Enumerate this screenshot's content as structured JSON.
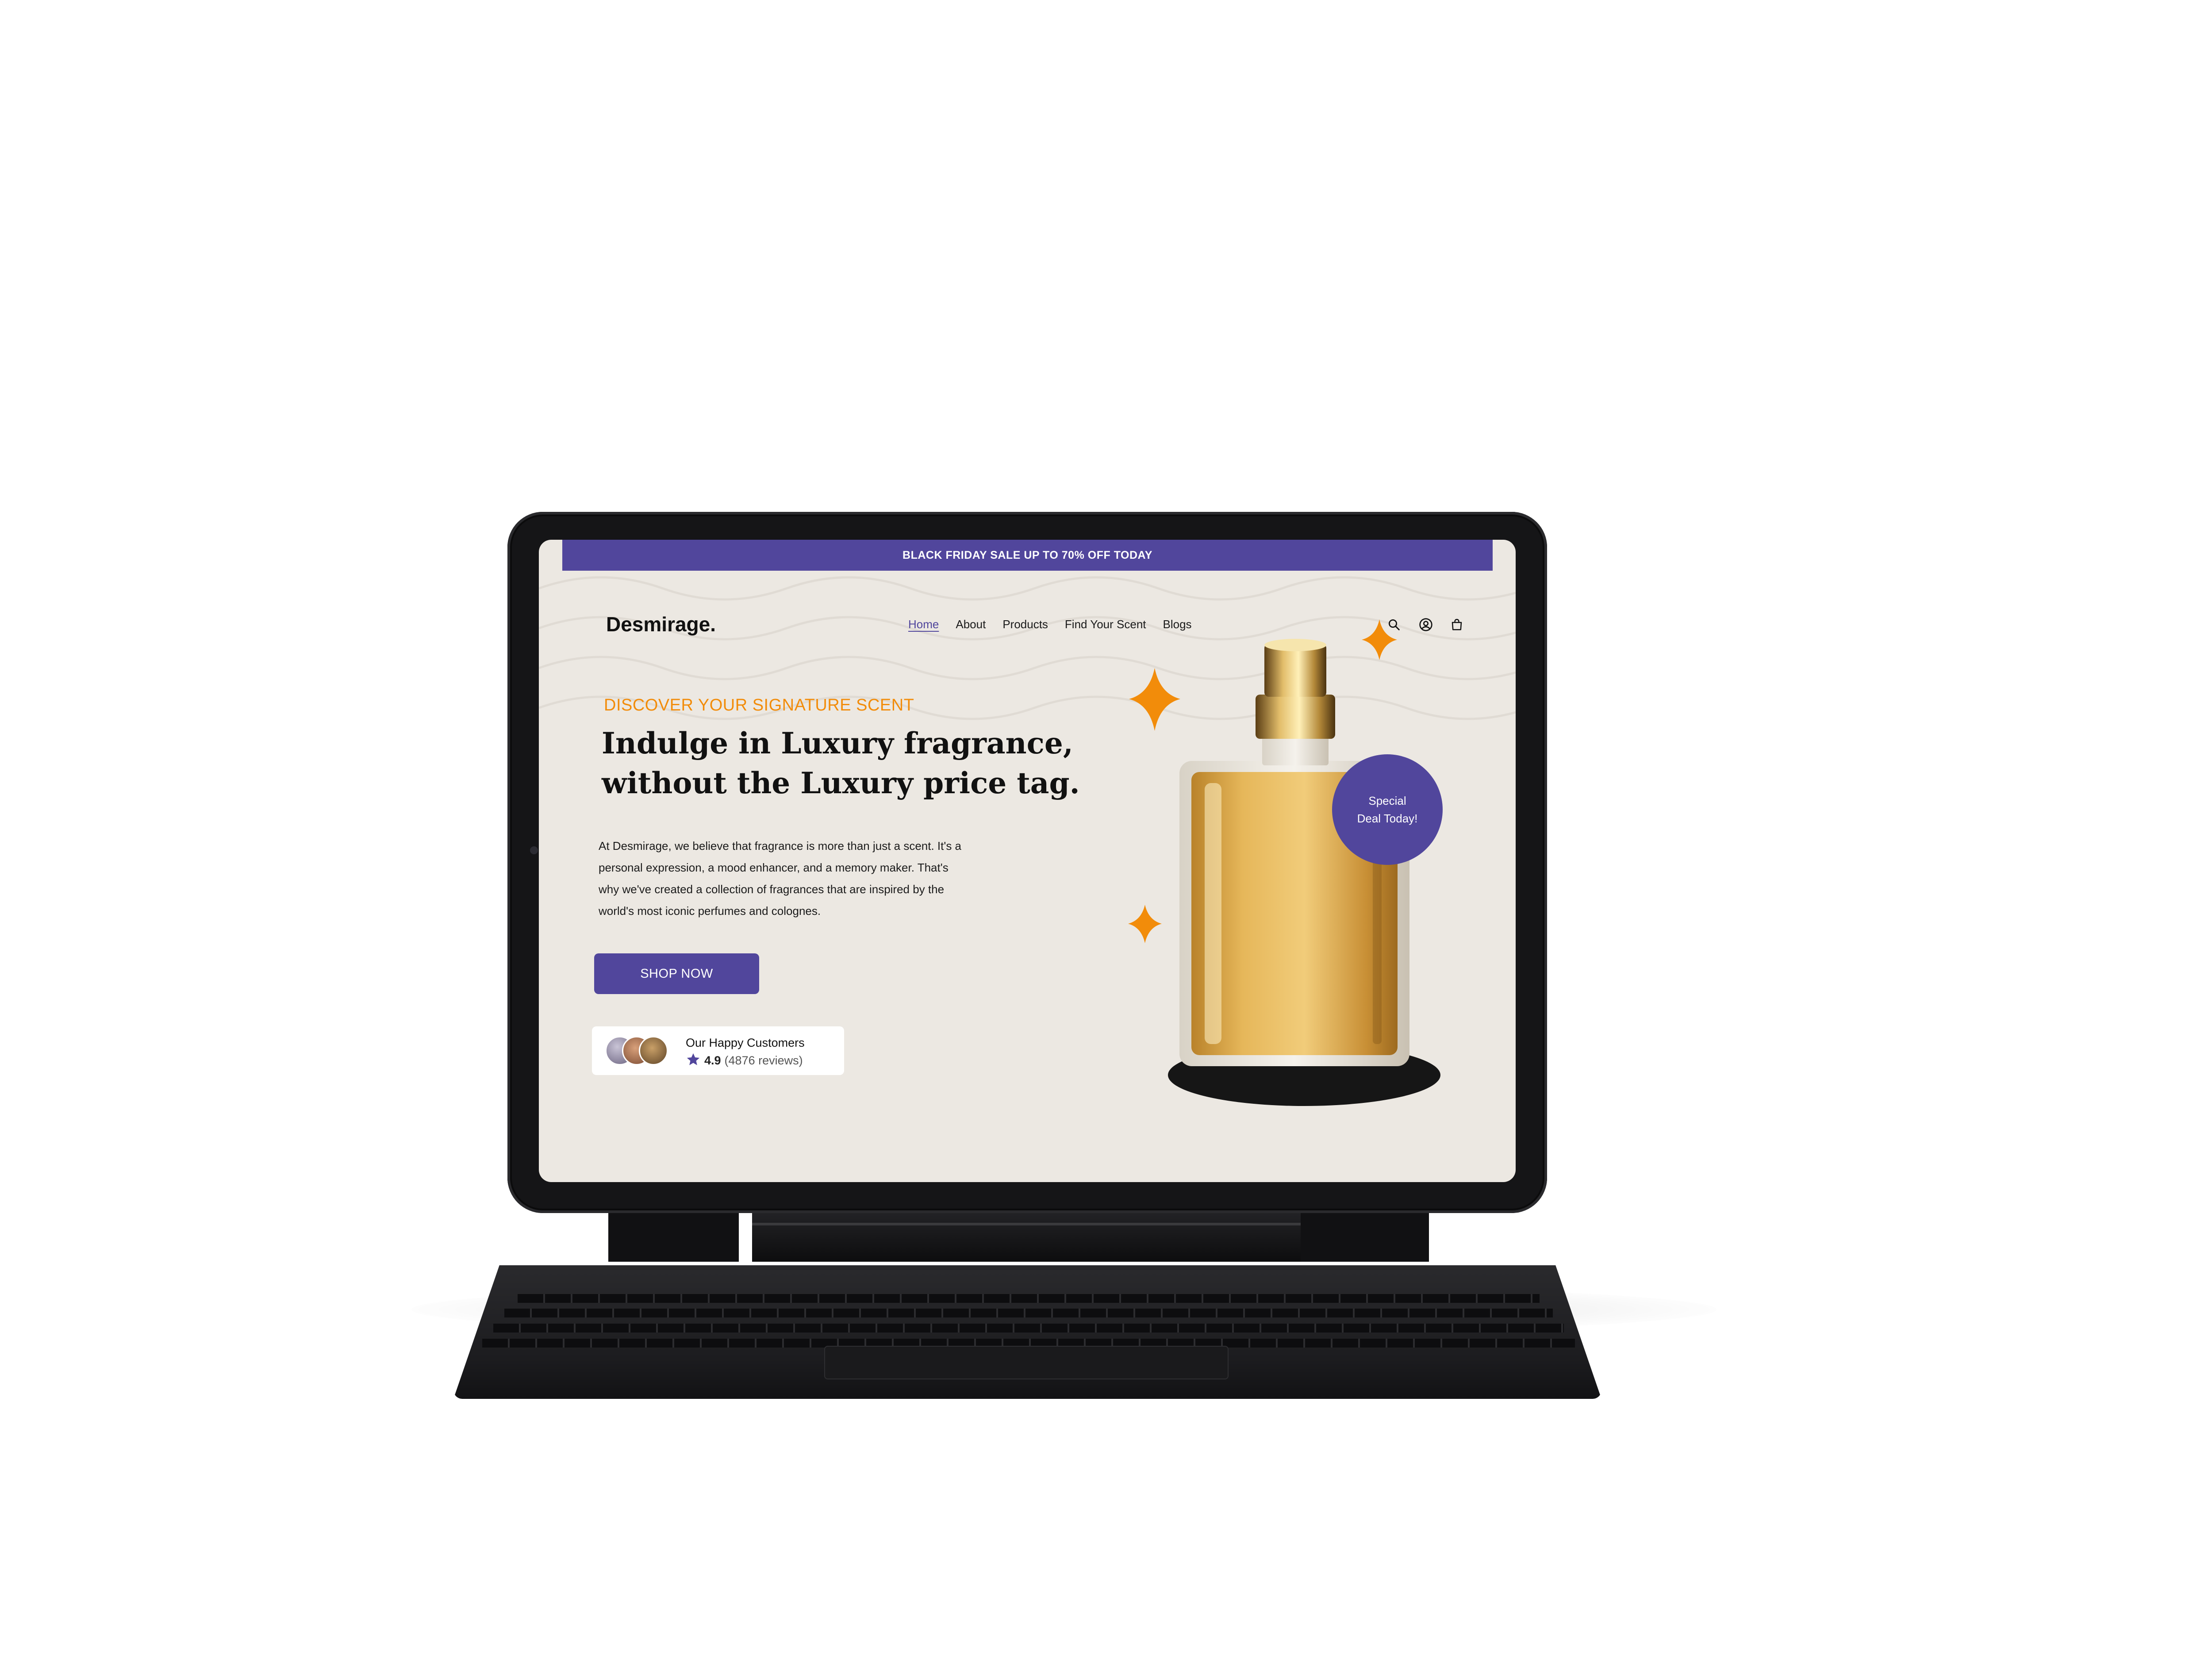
{
  "promo": {
    "text": "BLACK FRIDAY SALE UP TO 70% OFF TODAY"
  },
  "header": {
    "brand": "Desmirage.",
    "nav": [
      "Home",
      "About",
      "Products",
      "Find Your Scent",
      "Blogs"
    ],
    "active_nav": "Home",
    "icons": [
      "search-icon",
      "account-icon",
      "cart-icon"
    ]
  },
  "hero": {
    "kicker": "DISCOVER YOUR SIGNATURE SCENT",
    "headline_line1": "Indulge in Luxury fragrance,",
    "headline_line2": "without the Luxury price tag.",
    "description_lines": [
      "At Desmirage, we believe that fragrance is more than just a scent. It's a",
      "personal expression, a mood enhancer, and a memory maker. That's",
      "why we've created a collection of fragrances that are inspired by the",
      "world's most iconic perfumes and colognes."
    ],
    "cta_label": "SHOP NOW"
  },
  "reviews": {
    "title": "Our Happy Customers",
    "score": "4.9",
    "count_text": "(4876 reviews)"
  },
  "badge": {
    "line1": "Special",
    "line2": "Deal Today!"
  },
  "colors": {
    "primary": "#51469c",
    "accent": "#f28c0a",
    "background": "#ece8e2",
    "perfume": "#d9a43a"
  }
}
